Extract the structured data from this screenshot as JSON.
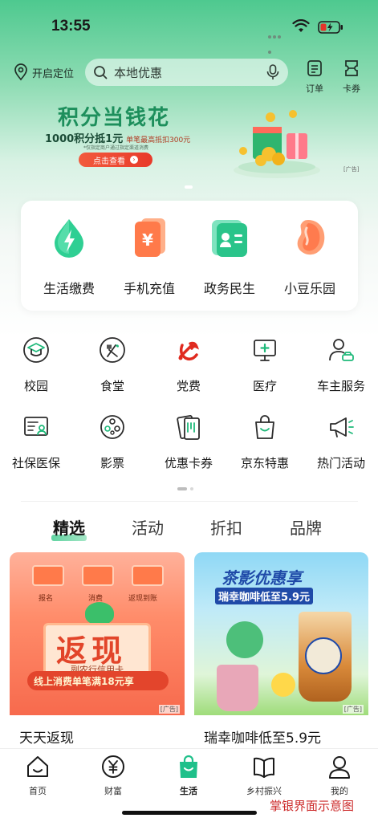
{
  "status_bar": {
    "time": "13:55"
  },
  "header": {
    "location_label": "开启定位",
    "search_placeholder": "本地优惠",
    "orders_label": "订单",
    "coupons_label": "卡券"
  },
  "banner": {
    "title": "积分当钱花",
    "subtitle_main": "1000积分抵1元",
    "subtitle_extra": "单笔最高抵扣300元",
    "note": "*仅指定商户通过指定渠道消费",
    "cta": "点击查看",
    "ad_tag": "[广告]"
  },
  "services": [
    {
      "label": "生活缴费",
      "icon": "lightning-drop-icon"
    },
    {
      "label": "手机充值",
      "icon": "yuan-phone-icon"
    },
    {
      "label": "政务民生",
      "icon": "id-card-icon"
    },
    {
      "label": "小豆乐园",
      "icon": "bean-icon"
    }
  ],
  "grid": [
    {
      "label": "校园",
      "icon": "graduation-cap-icon"
    },
    {
      "label": "食堂",
      "icon": "utensils-icon"
    },
    {
      "label": "党费",
      "icon": "party-emblem-icon"
    },
    {
      "label": "医疗",
      "icon": "medical-monitor-icon"
    },
    {
      "label": "车主服务",
      "icon": "car-user-icon"
    },
    {
      "label": "社保医保",
      "icon": "social-security-icon"
    },
    {
      "label": "影票",
      "icon": "film-reel-icon"
    },
    {
      "label": "优惠卡券",
      "icon": "coupon-cards-icon"
    },
    {
      "label": "京东特惠",
      "icon": "shopping-bag-icon"
    },
    {
      "label": "热门活动",
      "icon": "megaphone-icon"
    }
  ],
  "tabs": [
    "精选",
    "活动",
    "折扣",
    "品牌"
  ],
  "feed": [
    {
      "caption": "天天返现",
      "ad_tag": "[广告]",
      "flow": [
        "报名",
        "消费",
        "返现到账"
      ],
      "headline": "返现",
      "card_name": "副农行信用卡",
      "promo": "线上消费单笔满18元享"
    },
    {
      "caption": "瑞幸咖啡低至5.9元",
      "ad_tag": "[广告]",
      "headline": "茶影优惠享",
      "promo": "瑞幸咖啡低至5.9元"
    }
  ],
  "bottom_nav": [
    {
      "label": "首页",
      "icon": "home-icon"
    },
    {
      "label": "财富",
      "icon": "yuan-circle-icon"
    },
    {
      "label": "生活",
      "icon": "shopping-bag-icon"
    },
    {
      "label": "乡村振兴",
      "icon": "book-icon"
    },
    {
      "label": "我的",
      "icon": "user-icon"
    }
  ],
  "watermark": "掌银界面示意图",
  "colors": {
    "brand_green": "#1fb97a",
    "accent_red": "#e8402c"
  }
}
